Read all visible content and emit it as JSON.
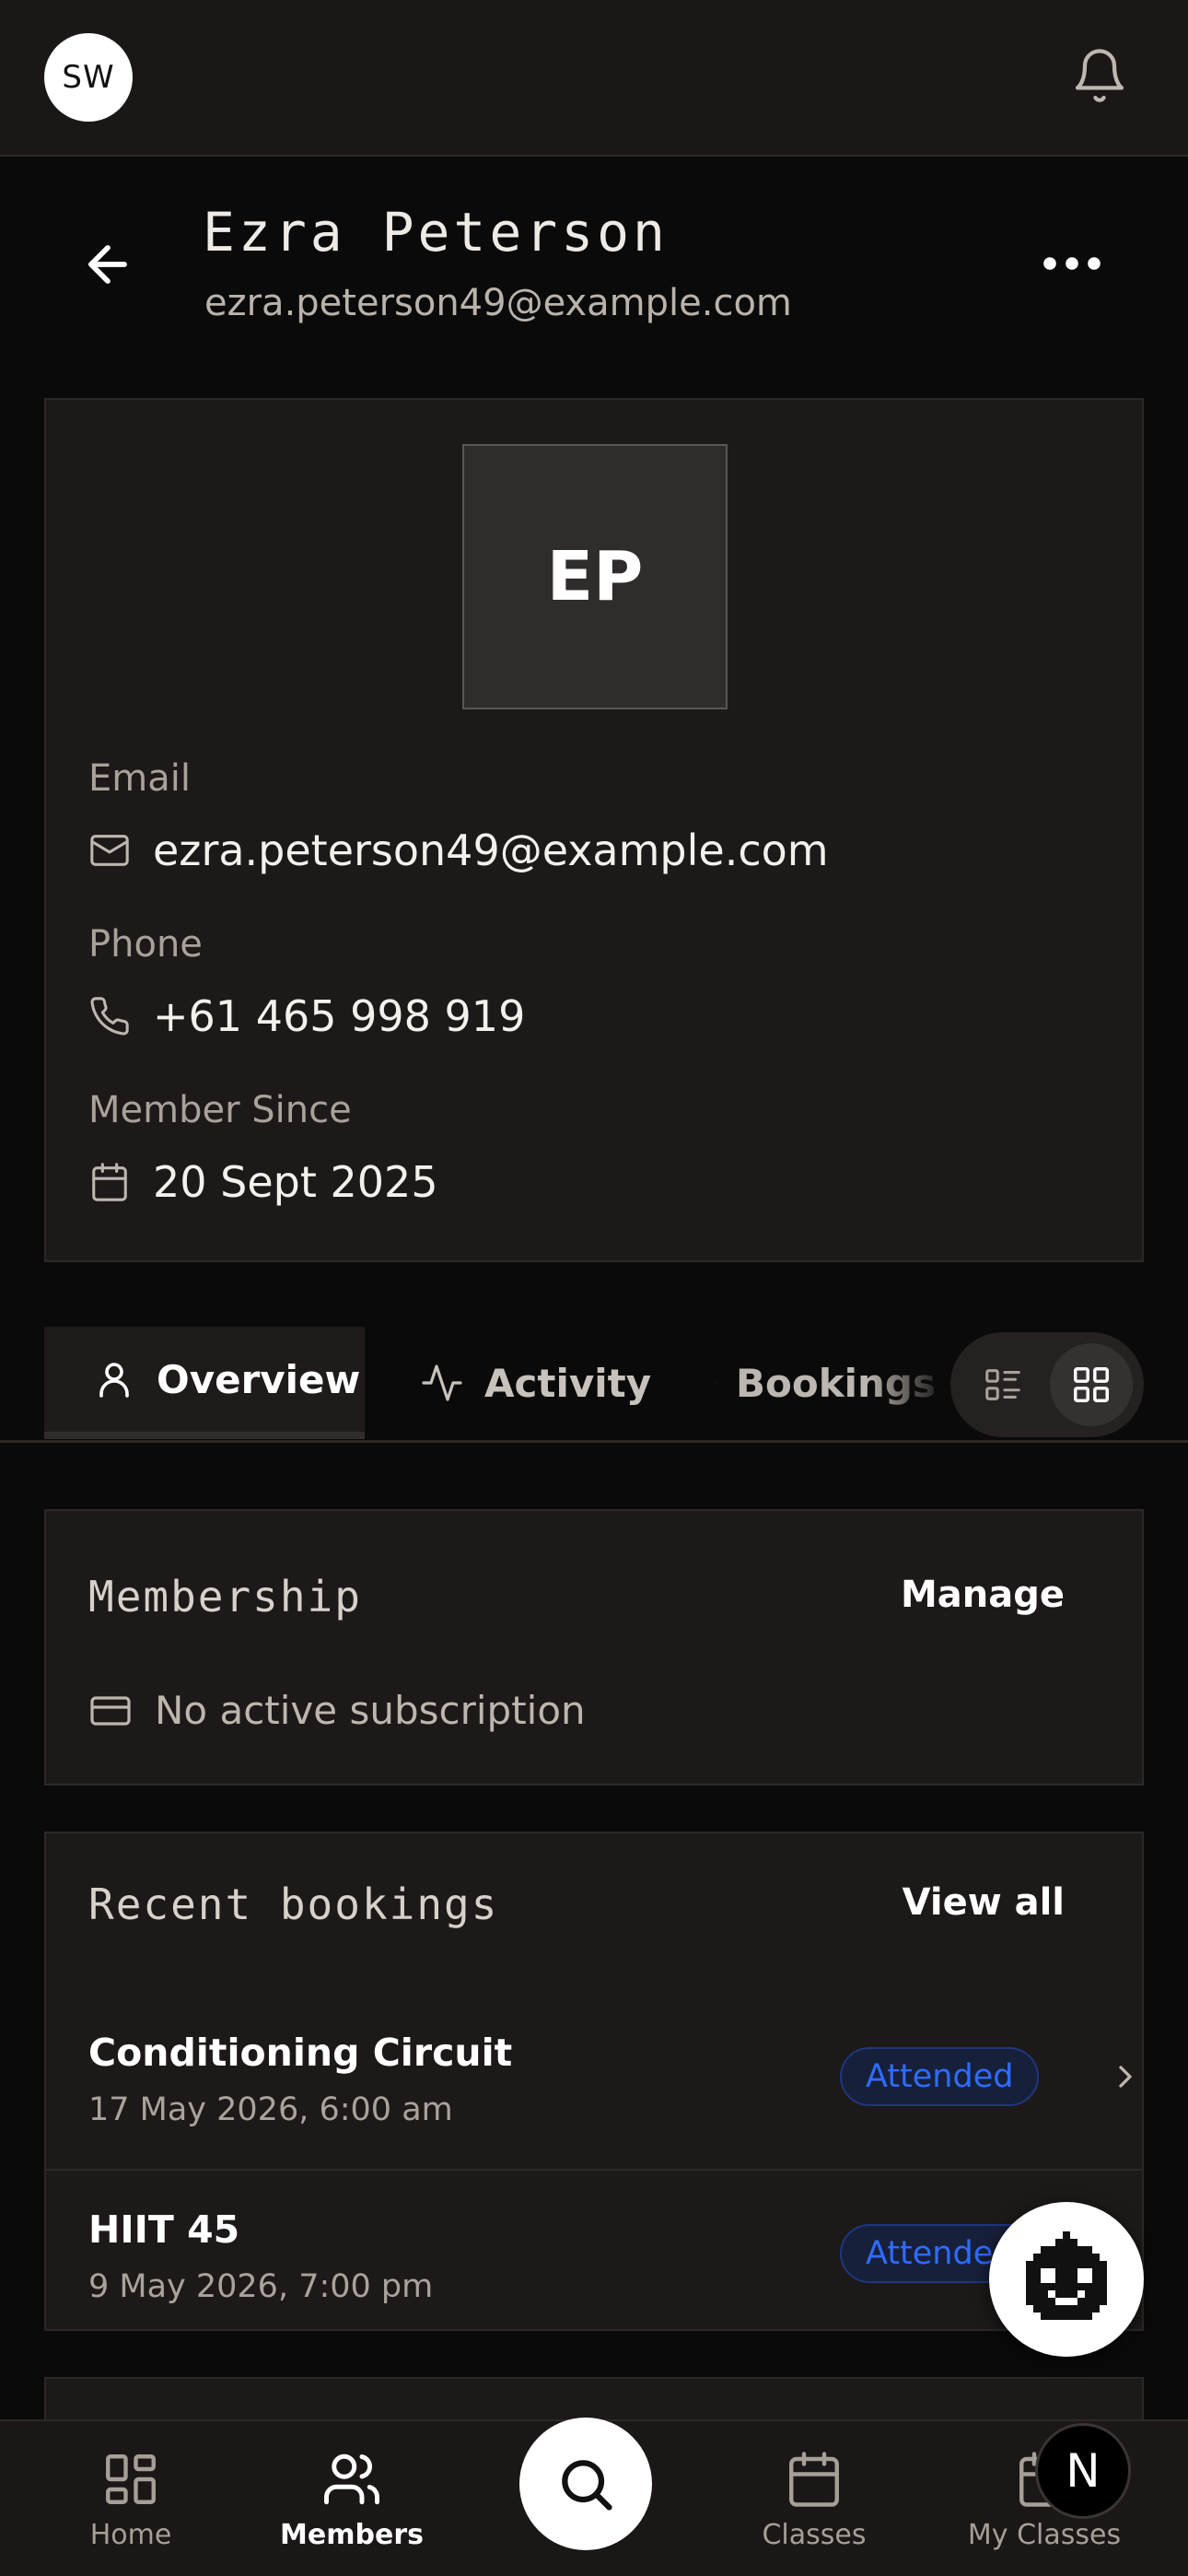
{
  "topbar": {
    "user_initials": "SW",
    "bell_icon": "bell-icon"
  },
  "header": {
    "name": "Ezra Peterson",
    "email": "ezra.peterson49@example.com",
    "back_icon": "arrow-left-icon",
    "more_icon": "more-horizontal-icon"
  },
  "profile": {
    "initials": "EP",
    "fields": [
      {
        "label": "Email",
        "value": "ezra.peterson49@example.com",
        "icon": "mail-icon"
      },
      {
        "label": "Phone",
        "value": "+61 465 998 919",
        "icon": "phone-icon"
      },
      {
        "label": "Member Since",
        "value": "20 Sept 2025",
        "icon": "calendar-icon"
      }
    ]
  },
  "tabs": [
    {
      "label": "Overview",
      "icon": "user-icon",
      "active": true
    },
    {
      "label": "Activity",
      "icon": "activity-icon",
      "active": false
    },
    {
      "label": "Bookings",
      "icon": "clock-icon",
      "active": false
    }
  ],
  "view_toggle": {
    "options": [
      "list-view-icon",
      "grid-view-icon"
    ],
    "selected": "grid-view-icon"
  },
  "membership": {
    "title": "Membership",
    "action": "Manage",
    "status": "No active subscription"
  },
  "recent_bookings": {
    "title": "Recent bookings",
    "action": "View all",
    "items": [
      {
        "name": "Conditioning Circuit",
        "date": "17 May 2026, 6:00 am",
        "status": "Attended"
      },
      {
        "name": "HIIT 45",
        "date": "9 May 2026, 7:00 pm",
        "status": "Attended"
      }
    ]
  },
  "bottom_nav": {
    "items": [
      {
        "label": "Home",
        "icon": "grid-icon",
        "active": false
      },
      {
        "label": "Members",
        "icon": "users-icon",
        "active": true
      },
      {
        "label": "Classes",
        "icon": "calendar-icon",
        "active": false
      },
      {
        "label": "My Classes",
        "icon": "calendar-icon",
        "active": false
      }
    ],
    "search_icon": "search-icon",
    "badge_letter": "N"
  },
  "colors": {
    "background": "#0b0a0a",
    "card": "#1c1918",
    "badge_text": "#2f6bff",
    "badge_bg": "#17203a"
  }
}
